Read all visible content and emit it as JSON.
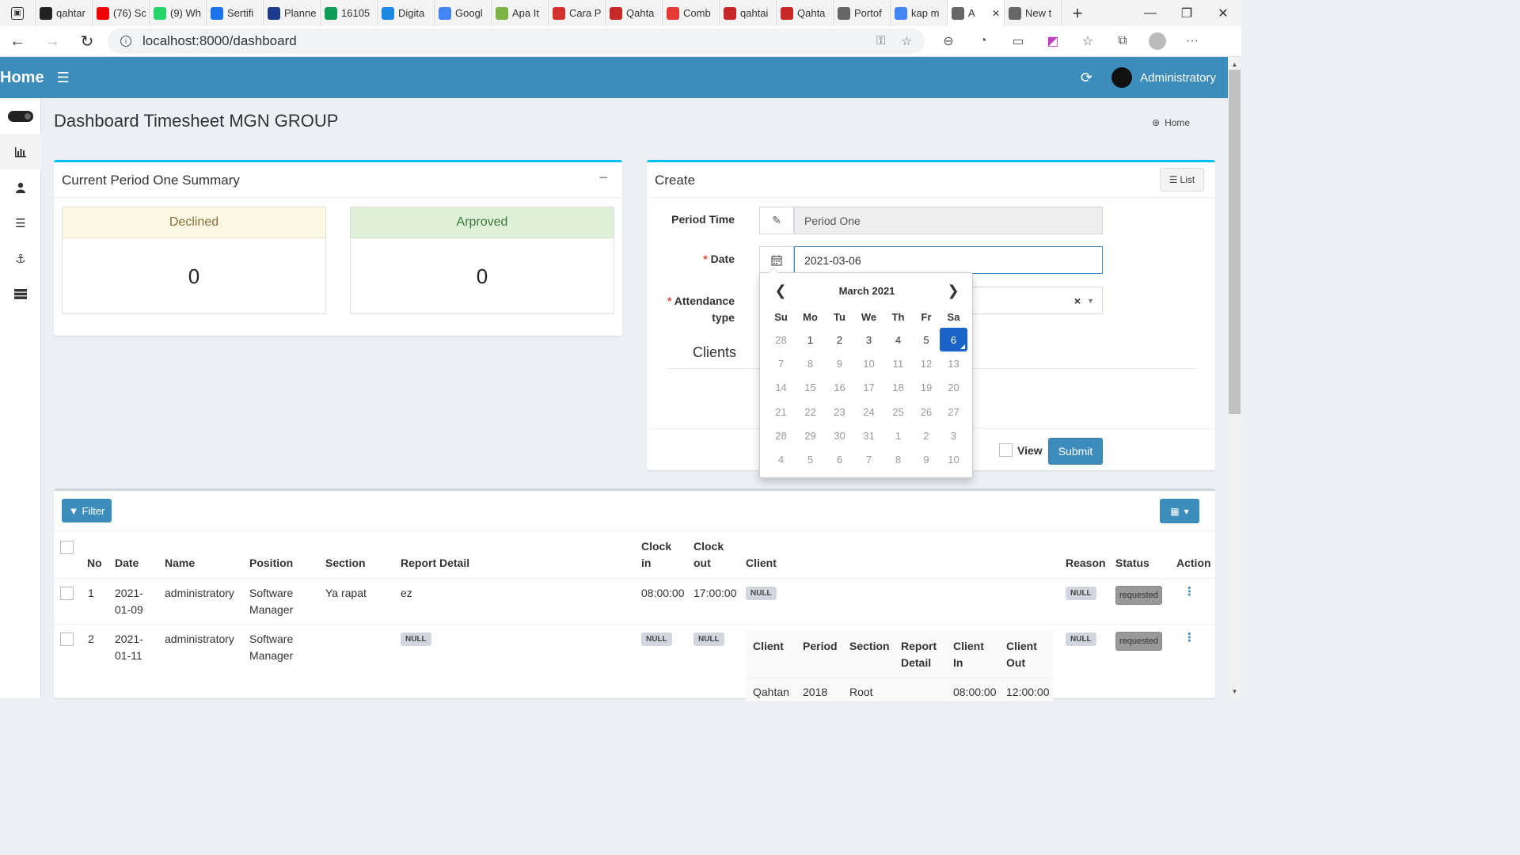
{
  "browser": {
    "tabs": [
      {
        "label": "qahtar",
        "color": "#222"
      },
      {
        "label": "(76) Sc",
        "color": "#e00"
      },
      {
        "label": "(9) Wh",
        "color": "#25d366"
      },
      {
        "label": "Sertifi",
        "color": "#1a73e8"
      },
      {
        "label": "Planne",
        "color": "#1e3a8a"
      },
      {
        "label": "16105",
        "color": "#0f9d58"
      },
      {
        "label": "Digita",
        "color": "#1e88e5"
      },
      {
        "label": "Googl",
        "color": "#4285f4"
      },
      {
        "label": "Apa It",
        "color": "#7cb342"
      },
      {
        "label": "Cara P",
        "color": "#d32f2f"
      },
      {
        "label": "Qahta",
        "color": "#c62828"
      },
      {
        "label": "Comb",
        "color": "#e53935"
      },
      {
        "label": "qahtai",
        "color": "#c62828"
      },
      {
        "label": "Qahta",
        "color": "#c62828"
      },
      {
        "label": "Portof",
        "color": "#666"
      },
      {
        "label": "kap m",
        "color": "#4285f4"
      },
      {
        "label": "A",
        "color": "#666"
      },
      {
        "label": "New t",
        "color": "#666"
      }
    ],
    "url": "localhost:8000/dashboard"
  },
  "header": {
    "logo": "Home",
    "user_name": "Administratory"
  },
  "page": {
    "title": "Dashboard Timesheet MGN GROUP",
    "breadcrumb": "Home"
  },
  "summary": {
    "title": "Current Period One Summary",
    "declined_label": "Declined",
    "declined_value": "0",
    "approved_label": "Arproved",
    "approved_value": "0"
  },
  "create": {
    "title": "Create",
    "list_label": "List",
    "period_label": "Period Time",
    "period_value": "Period One",
    "date_label": "Date",
    "date_value": "2021-03-06",
    "attendance_label_1": "Attendance",
    "attendance_label_2": "type",
    "clients_label": "Clients",
    "view_label": "View",
    "submit_label": "Submit"
  },
  "datepicker": {
    "month": "March 2021",
    "days_of_week": [
      "Su",
      "Mo",
      "Tu",
      "We",
      "Th",
      "Fr",
      "Sa"
    ],
    "weeks": [
      [
        "28",
        "1",
        "2",
        "3",
        "4",
        "5",
        "6"
      ],
      [
        "7",
        "8",
        "9",
        "10",
        "11",
        "12",
        "13"
      ],
      [
        "14",
        "15",
        "16",
        "17",
        "18",
        "19",
        "20"
      ],
      [
        "21",
        "22",
        "23",
        "24",
        "25",
        "26",
        "27"
      ],
      [
        "28",
        "29",
        "30",
        "31",
        "1",
        "2",
        "3"
      ],
      [
        "4",
        "5",
        "6",
        "7",
        "8",
        "9",
        "10"
      ]
    ],
    "selected": "6"
  },
  "table": {
    "filter_label": "Filter",
    "headers": {
      "no": "No",
      "date": "Date",
      "name": "Name",
      "position": "Position",
      "section": "Section",
      "report": "Report Detail",
      "clock_in_1": "Clock",
      "clock_in_2": "in",
      "clock_out_1": "Clock",
      "clock_out_2": "out",
      "client": "Client",
      "reason": "Reason",
      "status": "Status",
      "action": "Action"
    },
    "rows": [
      {
        "no": "1",
        "date_1": "2021-",
        "date_2": "01-09",
        "name": "administratory",
        "position_1": "Software",
        "position_2": "Manager",
        "section": "Ya rapat",
        "report": "ez",
        "clock_in": "08:00:00",
        "clock_out": "17:00:00",
        "client": "NULL",
        "reason": "NULL",
        "status": "requested"
      },
      {
        "no": "2",
        "date_1": "2021-",
        "date_2": "01-11",
        "name": "administratory",
        "position_1": "Software",
        "position_2": "Manager",
        "section": "",
        "report": "NULL",
        "clock_in": "NULL",
        "clock_out": "NULL",
        "reason": "NULL",
        "status": "requested"
      }
    ],
    "nested": {
      "headers": {
        "client": "Client",
        "period": "Period",
        "section": "Section",
        "report_1": "Report",
        "report_2": "Detail",
        "client_in_1": "Client",
        "client_in_2": "In",
        "client_out_1": "Client",
        "client_out_2": "Out"
      },
      "row": {
        "client": "Qahtan",
        "period": "2018",
        "section": "Root",
        "client_in": "08:00:00",
        "client_out": "12:00:00"
      }
    }
  },
  "colors": {
    "header_bg": "#3c8dbc",
    "box_accent": "#00c0ef",
    "selected_day": "#1a63c9"
  }
}
